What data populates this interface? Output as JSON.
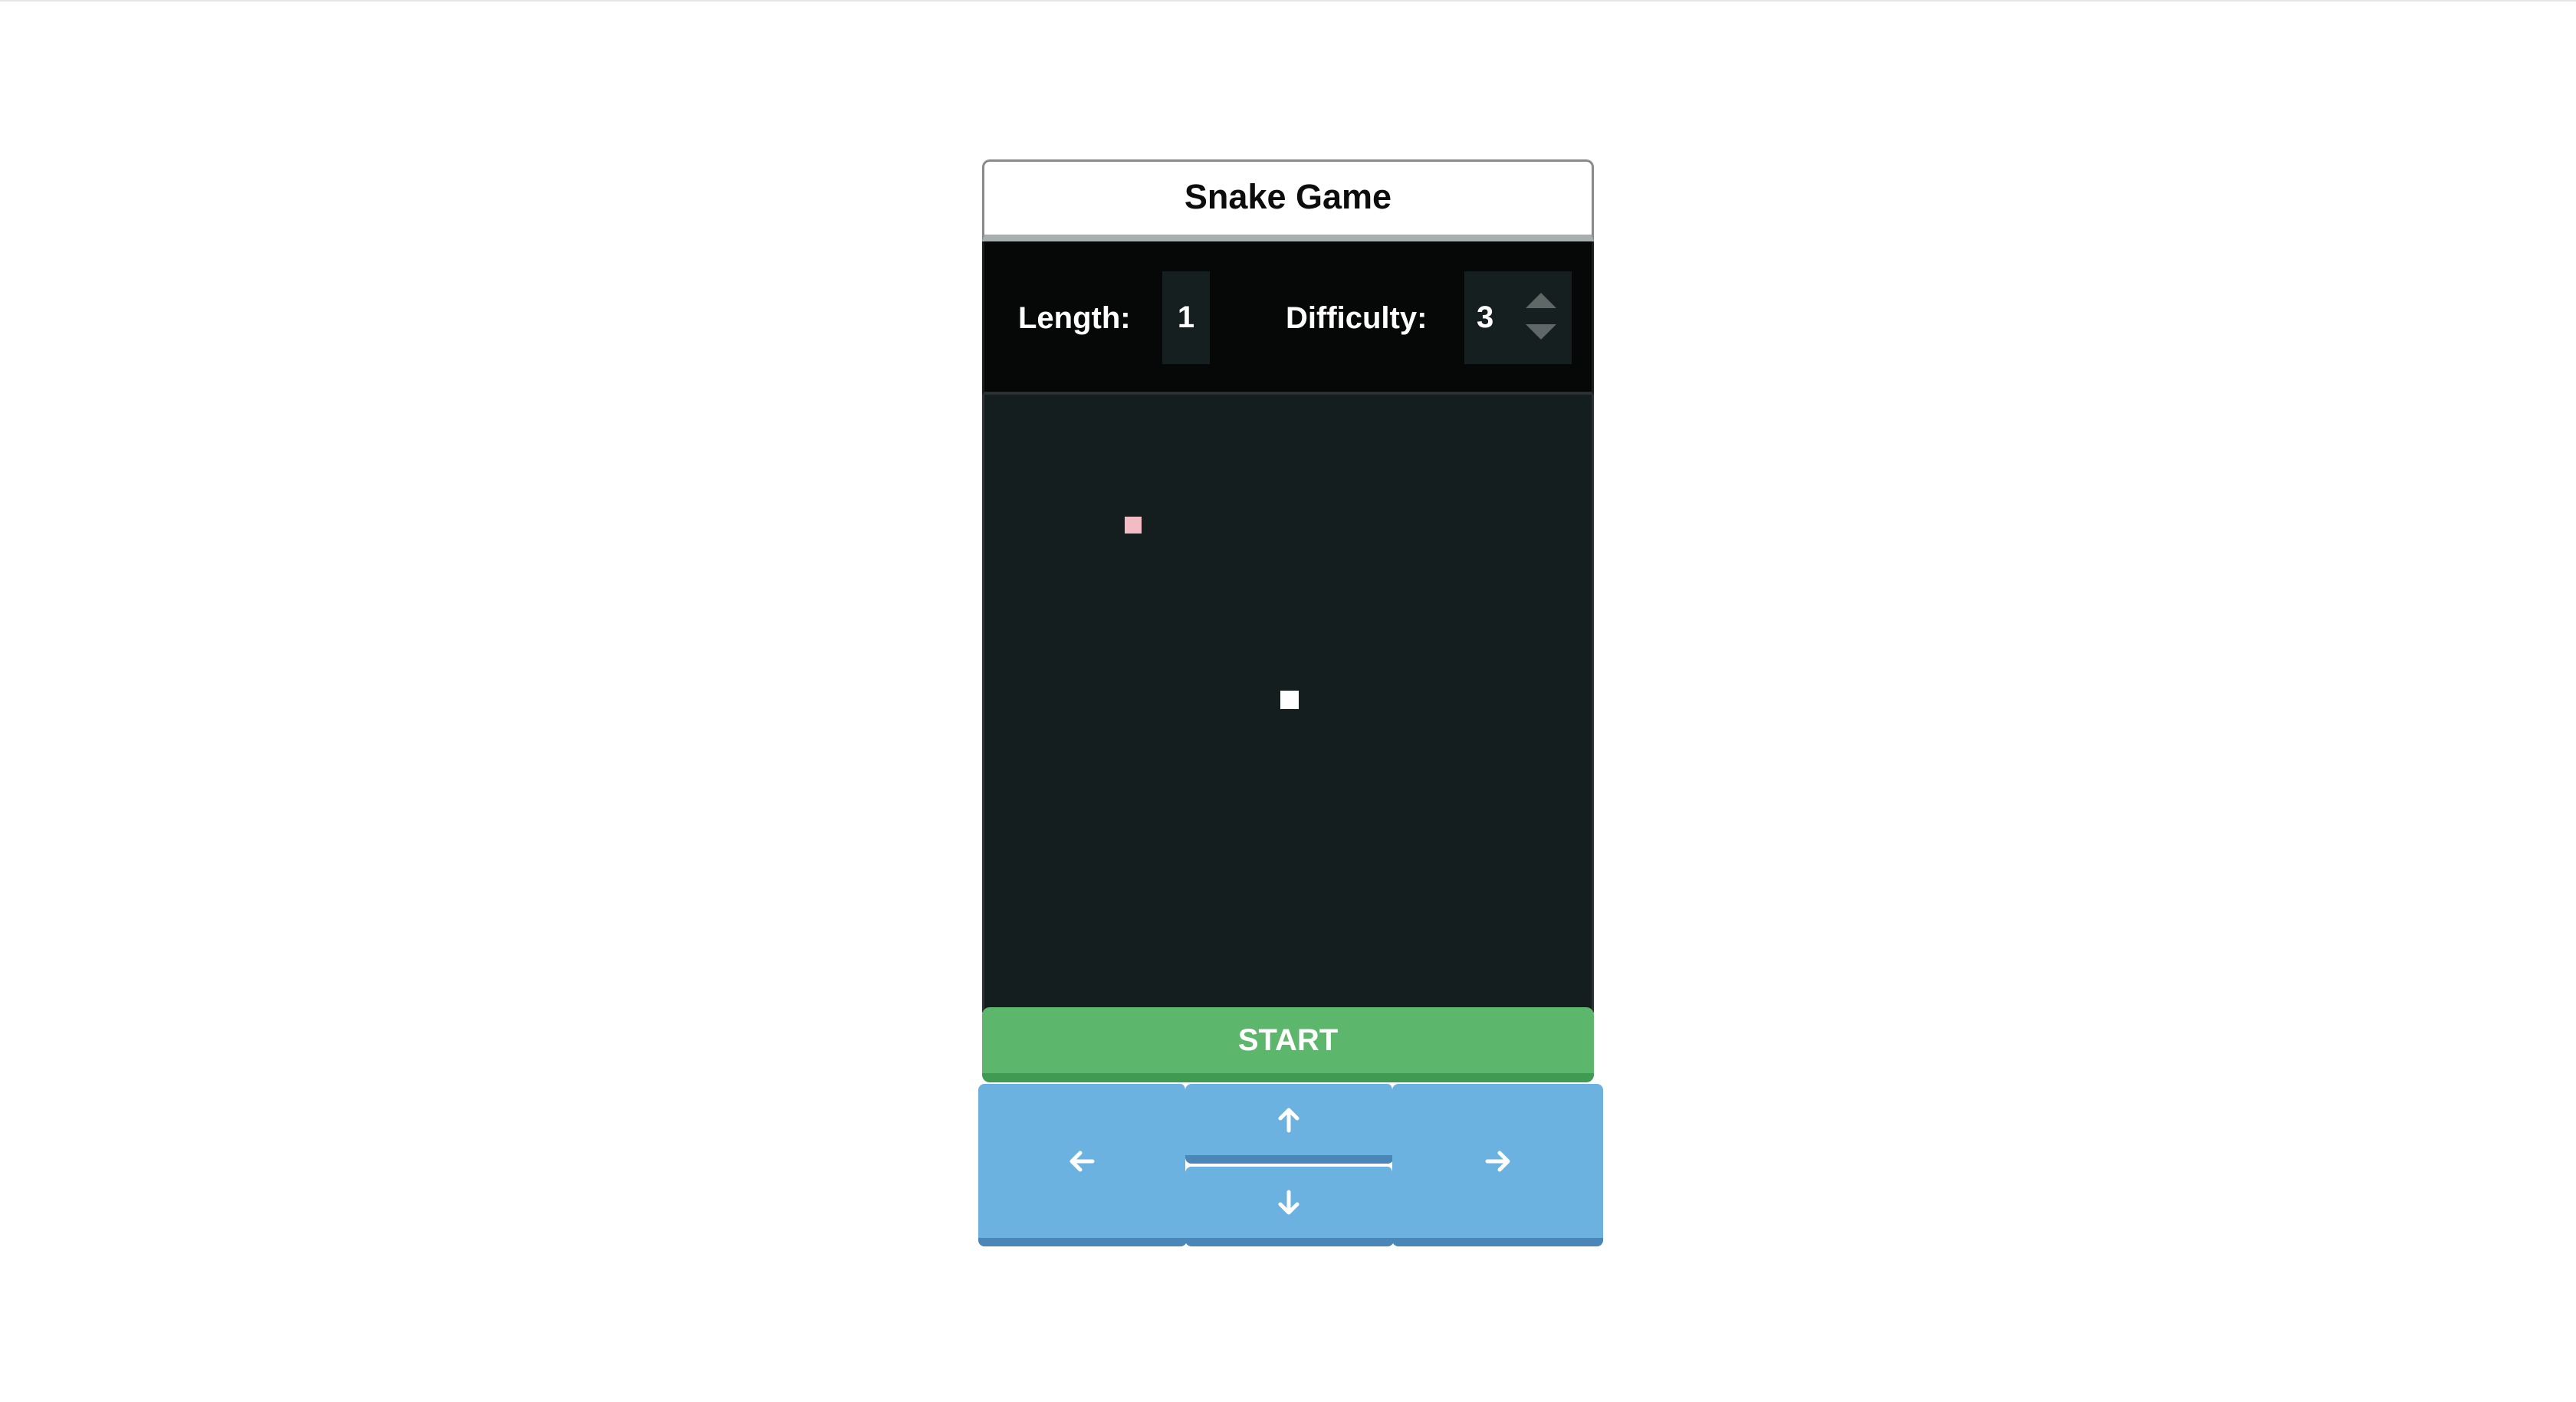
{
  "app": {
    "title": "Snake Game"
  },
  "stats": {
    "length_label": "Length:",
    "length_value": "1",
    "difficulty_label": "Difficulty:",
    "difficulty_value": "3"
  },
  "board": {
    "food_color": "#f3bcc4",
    "snake_color": "#ffffff",
    "background_color": "#141e1e"
  },
  "controls": {
    "start_label": "START",
    "left_icon": "arrow-left-icon",
    "up_icon": "arrow-up-icon",
    "down_icon": "arrow-down-icon",
    "right_icon": "arrow-right-icon",
    "start_color": "#5cb76c",
    "direction_color": "#6cb2e1"
  }
}
